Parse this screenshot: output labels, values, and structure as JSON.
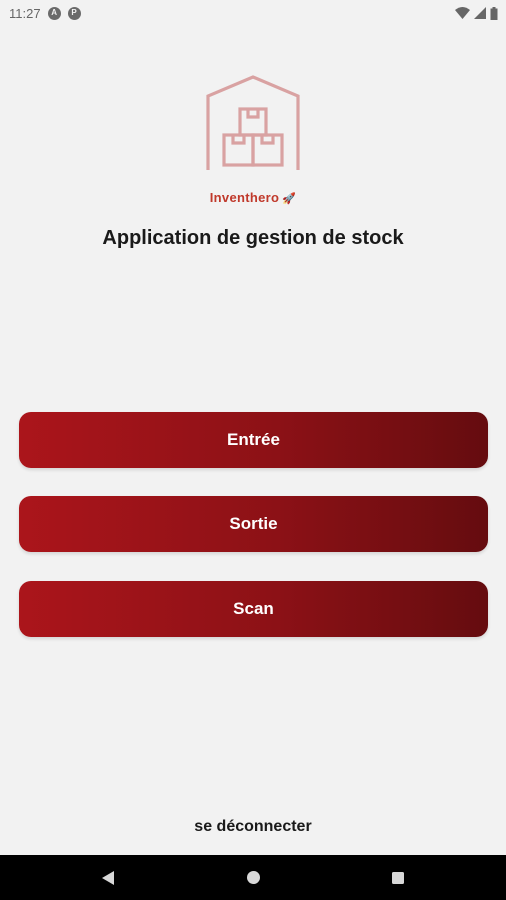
{
  "status_bar": {
    "time": "11:27",
    "notification_icons": [
      "app-a-icon",
      "app-p-icon"
    ],
    "system_icons": [
      "wifi-icon",
      "signal-icon",
      "battery-icon"
    ]
  },
  "app": {
    "brand_name": "Inventhero",
    "brand_emoji": "🚀",
    "title": "Application de gestion de stock",
    "logo_icon": "warehouse-boxes-icon"
  },
  "actions": {
    "entree_label": "Entrée",
    "sortie_label": "Sortie",
    "scan_label": "Scan"
  },
  "logout_label": "se déconnecter",
  "colors": {
    "accent": "#ab151b",
    "accent_dark": "#650c0f",
    "brand_text": "#c0392b",
    "logo": "#d9a2a2",
    "background": "#f2f2f2"
  },
  "nav_bar": {
    "icons": [
      "back-icon",
      "home-icon",
      "recents-icon"
    ]
  }
}
